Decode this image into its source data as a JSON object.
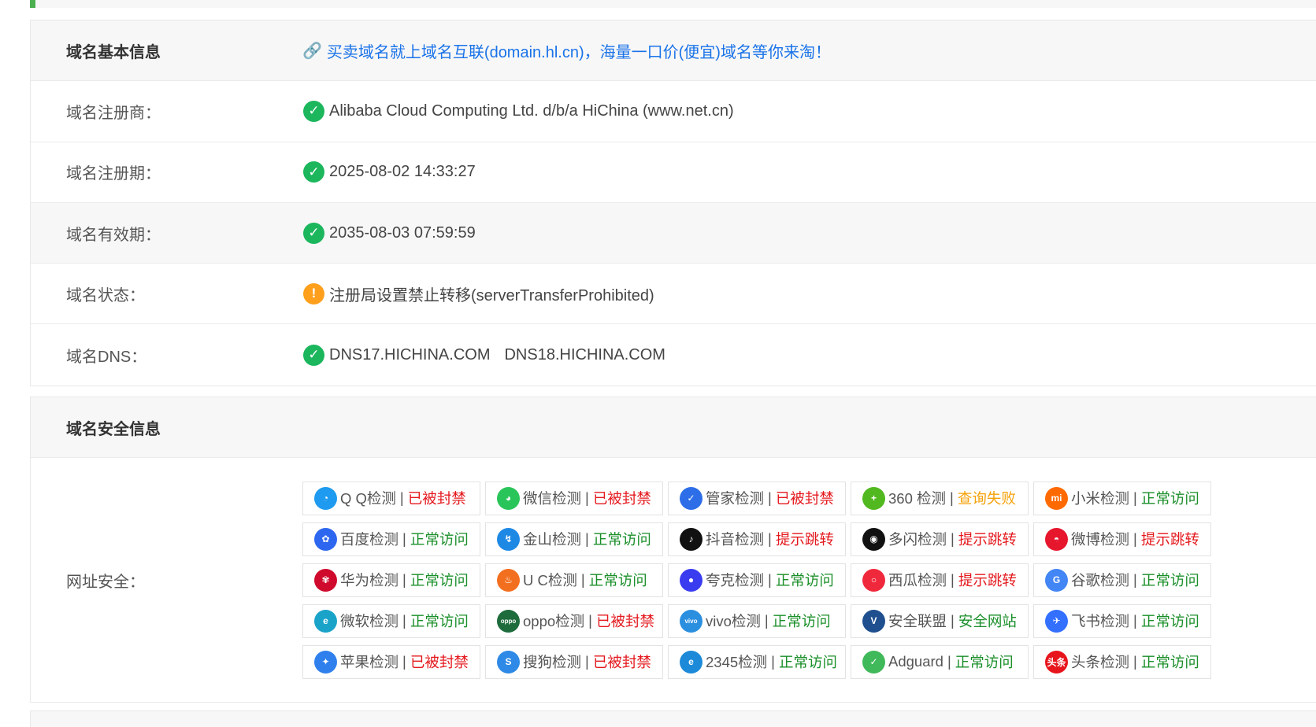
{
  "basic_info": {
    "header_label": "域名基本信息",
    "ad_text": "买卖域名就上域名互联(domain.hl.cn)，海量一口价(便宜)域名等你来淘！",
    "registrar_label": "域名注册商：",
    "registrar_value": "Alibaba Cloud Computing Ltd. d/b/a HiChina (www.net.cn)",
    "reg_date_label": "域名注册期：",
    "reg_date_value": "2025-08-02 14:33:27",
    "exp_date_label": "域名有效期：",
    "exp_date_value": "2035-08-03 07:59:59",
    "status_label": "域名状态：",
    "status_value": "注册局设置禁止转移(serverTransferProhibited)",
    "dns_label": "域名DNS：",
    "dns_1": "DNS17.HICHINA.COM",
    "dns_2": "DNS18.HICHINA.COM"
  },
  "security_info": {
    "header_label": "域名安全信息",
    "url_safety_label": "网址安全：",
    "checks": [
      {
        "name": "Q Q检测",
        "result": "已被封禁",
        "status": "red",
        "icon": "qq-icon",
        "icon_color": "#1e9bf0",
        "glyph": "◔"
      },
      {
        "name": "微信检测",
        "result": "已被封禁",
        "status": "red",
        "icon": "wechat-icon",
        "icon_color": "#2ac55a",
        "glyph": "◕"
      },
      {
        "name": "管家检测",
        "result": "已被封禁",
        "status": "red",
        "icon": "tencent-guard-icon",
        "icon_color": "#2d6ee8",
        "glyph": "✓"
      },
      {
        "name": "360 检测",
        "result": "查询失败",
        "status": "orange",
        "icon": "360-icon",
        "icon_color": "#52b820",
        "glyph": "+"
      },
      {
        "name": "小米检测",
        "result": "正常访问",
        "status": "green",
        "icon": "xiaomi-icon",
        "icon_color": "#ff6a00",
        "glyph": "mi"
      },
      {
        "name": "百度检测",
        "result": "正常访问",
        "status": "green",
        "icon": "baidu-icon",
        "icon_color": "#2d67f0",
        "glyph": "✿"
      },
      {
        "name": "金山检测",
        "result": "正常访问",
        "status": "green",
        "icon": "kingsoft-icon",
        "icon_color": "#1e88e5",
        "glyph": "↯"
      },
      {
        "name": "抖音检测",
        "result": "提示跳转",
        "status": "red",
        "icon": "douyin-icon",
        "icon_color": "#111111",
        "glyph": "♪"
      },
      {
        "name": "多闪检测",
        "result": "提示跳转",
        "status": "red",
        "icon": "duoshan-icon",
        "icon_color": "#111111",
        "glyph": "◉"
      },
      {
        "name": "微博检测",
        "result": "提示跳转",
        "status": "red",
        "icon": "weibo-icon",
        "icon_color": "#e6162d",
        "glyph": "◓"
      },
      {
        "name": "华为检测",
        "result": "正常访问",
        "status": "green",
        "icon": "huawei-icon",
        "icon_color": "#cf0a2c",
        "glyph": "✾"
      },
      {
        "name": "U C检测",
        "result": "正常访问",
        "status": "green",
        "icon": "uc-icon",
        "icon_color": "#f36f20",
        "glyph": "♨"
      },
      {
        "name": "夸克检测",
        "result": "正常访问",
        "status": "green",
        "icon": "quark-icon",
        "icon_color": "#3a3cf0",
        "glyph": "●"
      },
      {
        "name": "西瓜检测",
        "result": "提示跳转",
        "status": "red",
        "icon": "xigua-icon",
        "icon_color": "#f0283c",
        "glyph": "○"
      },
      {
        "name": "谷歌检测",
        "result": "正常访问",
        "status": "green",
        "icon": "google-icon",
        "icon_color": "#4285f4",
        "glyph": "G"
      },
      {
        "name": "微软检测",
        "result": "正常访问",
        "status": "green",
        "icon": "edge-icon",
        "icon_color": "#1aa3c8",
        "glyph": "e"
      },
      {
        "name": "oppo检测",
        "result": "已被封禁",
        "status": "red",
        "icon": "oppo-icon",
        "icon_color": "#1e6b3c",
        "glyph": "oppo"
      },
      {
        "name": "vivo检测",
        "result": "正常访问",
        "status": "green",
        "icon": "vivo-icon",
        "icon_color": "#2b8fe0",
        "glyph": "vivo"
      },
      {
        "name": "安全联盟",
        "result": "安全网站",
        "status": "green",
        "icon": "anquan-icon",
        "icon_color": "#1f4f8f",
        "glyph": "V"
      },
      {
        "name": "飞书检测",
        "result": "正常访问",
        "status": "green",
        "icon": "feishu-icon",
        "icon_color": "#3370ff",
        "glyph": "✈"
      },
      {
        "name": "苹果检测",
        "result": "已被封禁",
        "status": "red",
        "icon": "safari-icon",
        "icon_color": "#2f80ed",
        "glyph": "✦"
      },
      {
        "name": "搜狗检测",
        "result": "已被封禁",
        "status": "red",
        "icon": "sogou-icon",
        "icon_color": "#2e8ae6",
        "glyph": "S"
      },
      {
        "name": "2345检测",
        "result": "正常访问",
        "status": "green",
        "icon": "2345-icon",
        "icon_color": "#1c8ad8",
        "glyph": "e"
      },
      {
        "name": "Adguard",
        "result": "正常访问",
        "status": "green",
        "icon": "adguard-icon",
        "icon_color": "#3fb95a",
        "glyph": "✓"
      },
      {
        "name": "头条检测",
        "result": "正常访问",
        "status": "green",
        "icon": "toutiao-icon",
        "icon_color": "#e8141c",
        "glyph": "头条"
      }
    ]
  }
}
